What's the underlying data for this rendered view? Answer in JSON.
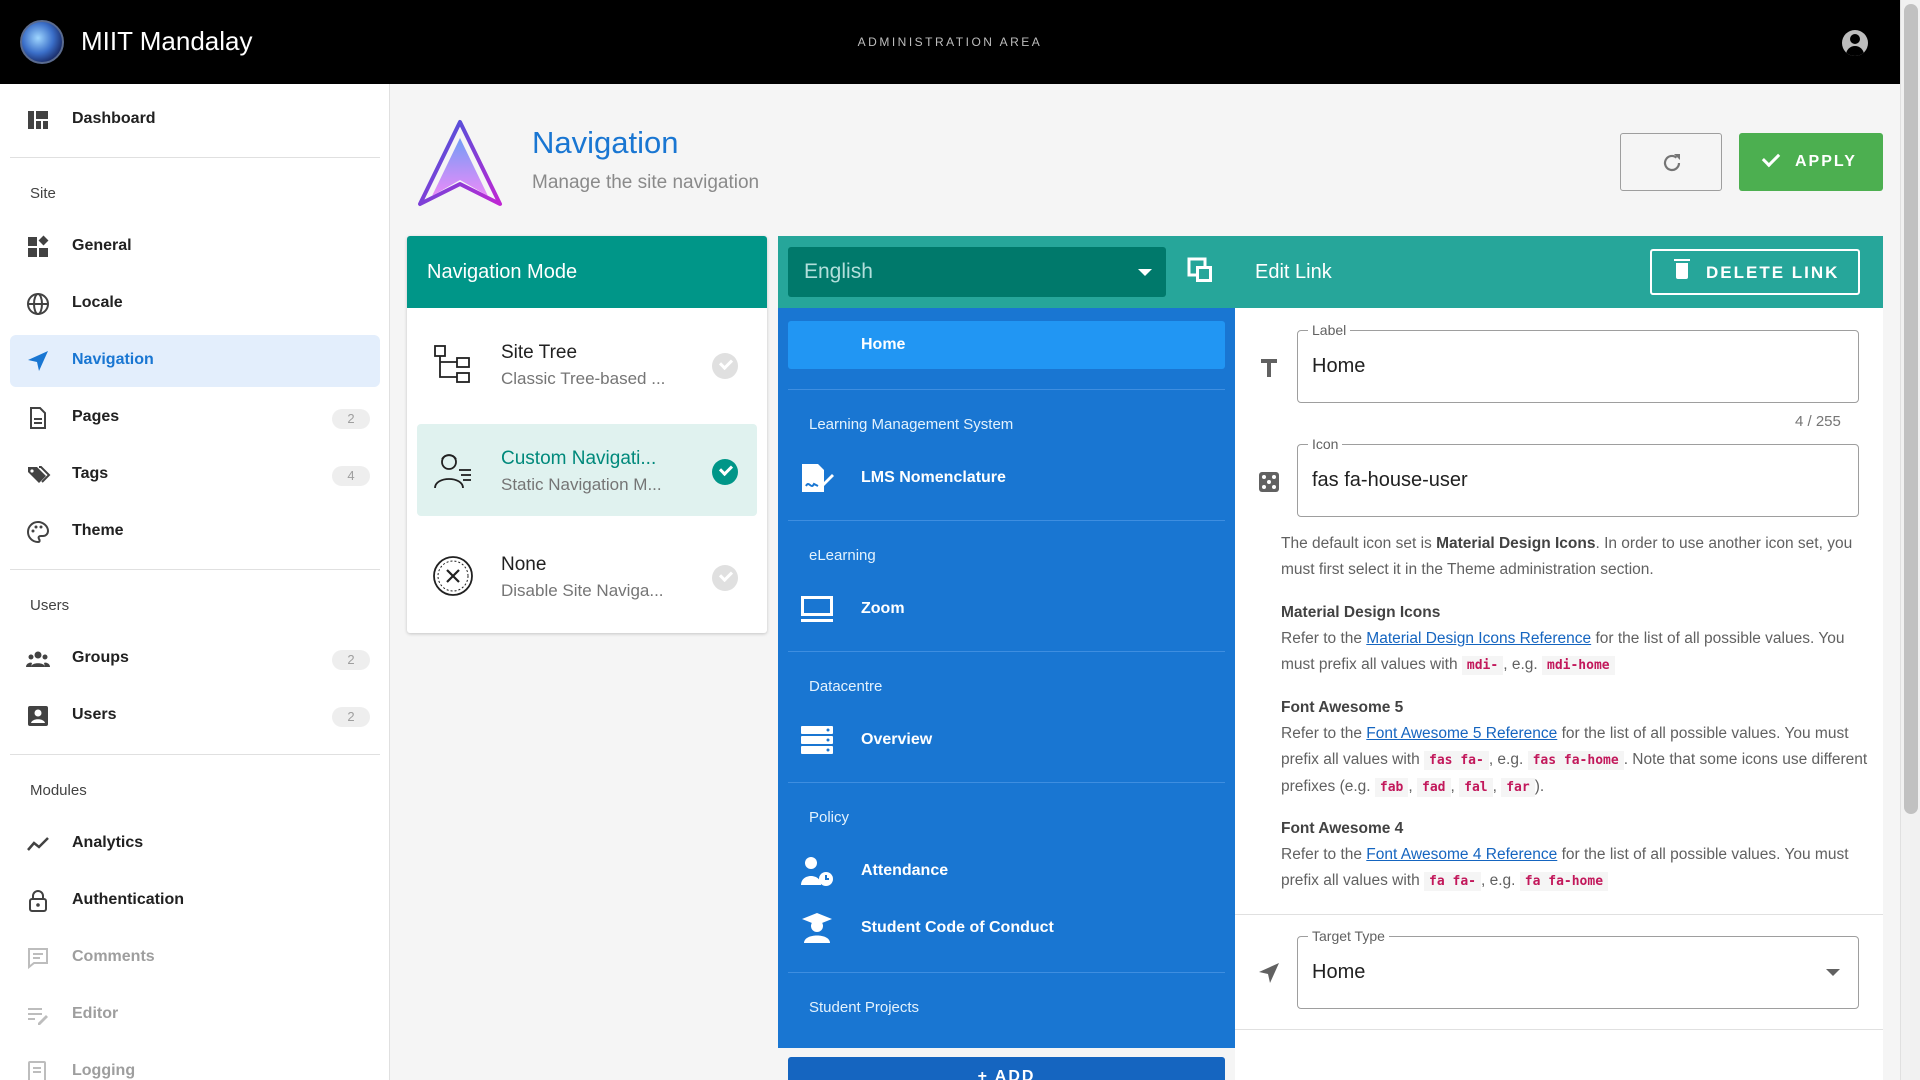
{
  "topbar": {
    "brand": "MIIT Mandalay",
    "area_label": "ADMINISTRATION AREA"
  },
  "sidebar": {
    "items_top": [
      {
        "label": "Dashboard",
        "icon": "dashboard-icon"
      }
    ],
    "section_site": "Site",
    "site_items": [
      {
        "label": "General",
        "icon": "widgets-icon"
      },
      {
        "label": "Locale",
        "icon": "globe-icon"
      },
      {
        "label": "Navigation",
        "icon": "navigation-arrow-icon",
        "active": true
      },
      {
        "label": "Pages",
        "icon": "page-icon",
        "count": "2"
      },
      {
        "label": "Tags",
        "icon": "tags-icon",
        "count": "4"
      },
      {
        "label": "Theme",
        "icon": "palette-icon"
      }
    ],
    "section_users": "Users",
    "user_items": [
      {
        "label": "Groups",
        "icon": "groups-icon",
        "count": "2"
      },
      {
        "label": "Users",
        "icon": "user-box-icon",
        "count": "2"
      }
    ],
    "section_modules": "Modules",
    "module_items": [
      {
        "label": "Analytics",
        "icon": "chart-line-icon"
      },
      {
        "label": "Authentication",
        "icon": "lock-icon"
      },
      {
        "label": "Comments",
        "icon": "comment-icon",
        "disabled": true
      },
      {
        "label": "Editor",
        "icon": "editor-icon",
        "disabled": true
      },
      {
        "label": "Logging",
        "icon": "log-icon",
        "disabled": true
      }
    ]
  },
  "header": {
    "title": "Navigation",
    "subtitle": "Manage the site navigation",
    "apply_label": "APPLY"
  },
  "mode": {
    "title": "Navigation Mode",
    "items": [
      {
        "title": "Site Tree",
        "subtitle": "Classic Tree-based ...",
        "selected": false
      },
      {
        "title": "Custom Navigati...",
        "subtitle": "Static Navigation M...",
        "selected": true
      },
      {
        "title": "None",
        "subtitle": "Disable Site Naviga...",
        "selected": false
      }
    ]
  },
  "editor": {
    "language": "English",
    "title": "Edit Link",
    "delete_label": "DELETE LINK",
    "add_label": "+ ADD"
  },
  "tree": {
    "home": "Home",
    "headers": [
      "Learning Management System",
      "eLearning",
      "Datacentre",
      "Policy",
      "Student Projects"
    ],
    "links": [
      "LMS Nomenclature",
      "Zoom",
      "Overview",
      "Attendance",
      "Student Code of Conduct"
    ]
  },
  "props": {
    "label_label": "Label",
    "label_value": "Home",
    "counter": "4 / 255",
    "icon_label": "Icon",
    "icon_value": "fas fa-house-user",
    "help_intro_1": "The default icon set is ",
    "help_intro_bold": "Material Design Icons",
    "help_intro_2": ". In order to use another icon set, you must first select it in the Theme administration section.",
    "mdi_title": "Material Design Icons",
    "mdi_pre": "Refer to the ",
    "mdi_link": "Material Design Icons Reference",
    "mdi_post": " for the list of all possible values. You must prefix all values with ",
    "mdi_code1": "mdi-",
    "mdi_eg": ", e.g. ",
    "mdi_code2": "mdi-home",
    "fa5_title": "Font Awesome 5",
    "fa5_pre": "Refer to the ",
    "fa5_link": "Font Awesome 5 Reference",
    "fa5_post": " for the list of all possible values. You must prefix all values with ",
    "fa5_code1": "fas fa-",
    "fa5_eg": ", e.g. ",
    "fa5_code2": "fas fa-home",
    "fa5_note": ". Note that some icons use different prefixes (e.g. ",
    "fa5_c3": "fab",
    "fa5_c4": "fad",
    "fa5_c5": "fal",
    "fa5_c6": "far",
    "fa5_end": ").",
    "fa4_title": "Font Awesome 4",
    "fa4_pre": "Refer to the ",
    "fa4_link": "Font Awesome 4 Reference",
    "fa4_post": " for the list of all possible values. You must prefix all values with ",
    "fa4_code1": "fa fa-",
    "fa4_eg": ", e.g. ",
    "fa4_code2": "fa fa-home",
    "target_label": "Target Type",
    "target_value": "Home"
  }
}
